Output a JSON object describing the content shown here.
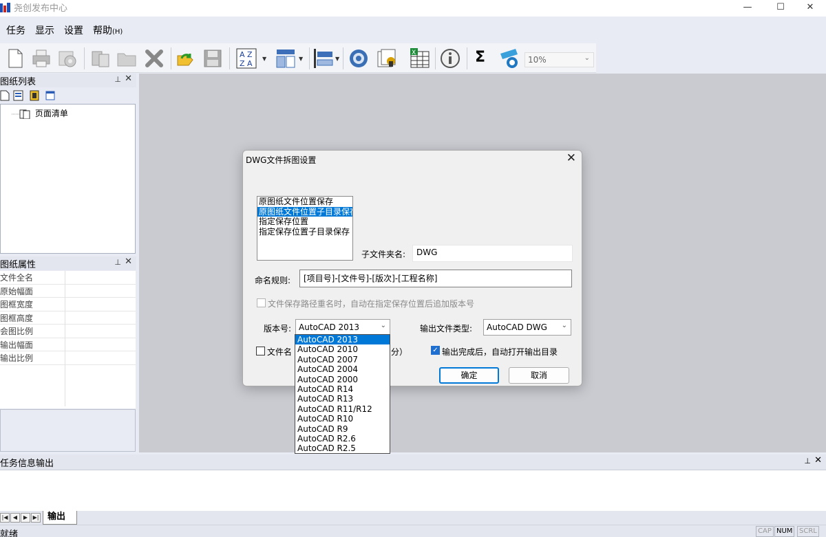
{
  "app": {
    "title": "尧创发布中心"
  },
  "window": {
    "minimize": "—",
    "maximize": "☐",
    "close": "✕"
  },
  "menu": {
    "items": [
      "任务",
      "显示",
      "设置"
    ],
    "help": "帮助",
    "help_key": "(H)"
  },
  "toolbar": {
    "zoom": "10%",
    "sigma": "Σ"
  },
  "drawing_list": {
    "title": "图纸列表",
    "root": "页面清单"
  },
  "properties": {
    "title": "图纸属性",
    "rows": [
      "文件全名",
      "原始幅面",
      "图框宽度",
      "图框高度",
      "会图比例",
      "输出幅面",
      "输出比例"
    ]
  },
  "output": {
    "title": "任务信息输出",
    "tab": "输出"
  },
  "status": {
    "text": "就绪",
    "cap": "CAP",
    "num": "NUM",
    "scrl": "SCRL"
  },
  "dialog": {
    "title": "DWG文件拆图设置",
    "save_options": [
      "原图纸文件位置保存",
      "原图纸文件位置子目录保存",
      "指定保存位置",
      "指定保存位置子目录保存"
    ],
    "subfolder_label": "子文件夹名:",
    "subfolder_value": "DWG",
    "naming_label": "命名规则:",
    "naming_value": "[项目号]-[文件号]-[版次]-[工程名称]",
    "rename_check": "文件保存路径重名时，自动在指定保存位置后追加版本号",
    "version_label": "版本号:",
    "version_value": "AutoCAD 2013",
    "output_type_label": "输出文件类型:",
    "output_type_value": "AutoCAD DWG",
    "filename_check_start": "文件名",
    "filename_check_end": "分）",
    "open_dir_check": "输出完成后，自动打开输出目录",
    "ok": "确定",
    "cancel": "取消"
  },
  "version_options": [
    "AutoCAD 2013",
    "AutoCAD 2010",
    "AutoCAD 2007",
    "AutoCAD 2004",
    "AutoCAD 2000",
    "AutoCAD R14",
    "AutoCAD R13",
    "AutoCAD R11/R12",
    "AutoCAD R10",
    "AutoCAD R9",
    "AutoCAD R2.6",
    "AutoCAD R2.5"
  ]
}
